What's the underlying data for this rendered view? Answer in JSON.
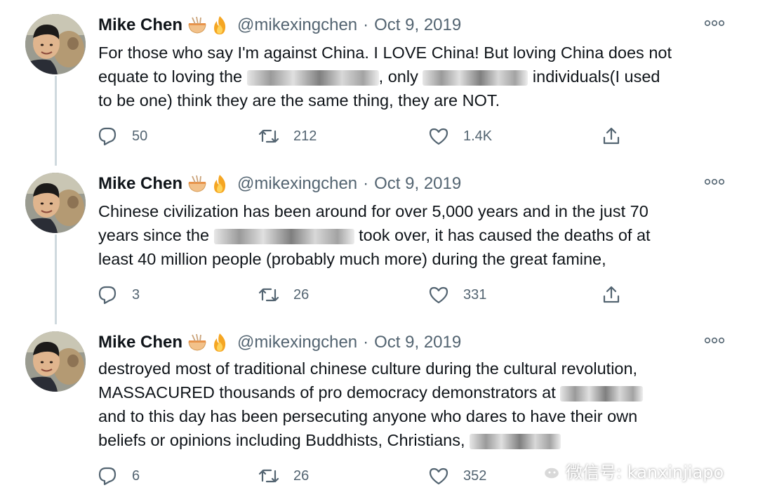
{
  "tweets": [
    {
      "author": "Mike Chen",
      "handle": "@mikexingchen",
      "separator": "·",
      "date": "Oct 9, 2019",
      "lines": [
        [
          "For those who say I'm against China. I LOVE China! But loving China does not"
        ],
        [
          "equate to loving the ",
          "",
          ", only ",
          "",
          " individuals(I used"
        ],
        [
          "to be one) think they are the same thing, they are NOT."
        ]
      ],
      "replies": "50",
      "retweets": "212",
      "likes": "1.4K"
    },
    {
      "author": "Mike Chen",
      "handle": "@mikexingchen",
      "separator": "·",
      "date": "Oct 9, 2019",
      "lines": [
        [
          "Chinese civilization has been around for over 5,000 years and in the just 70"
        ],
        [
          "years since the ",
          "",
          " took over, it has caused the deaths of at"
        ],
        [
          "least 40 million people (probably much more) during the great famine,"
        ]
      ],
      "replies": "3",
      "retweets": "26",
      "likes": "331"
    },
    {
      "author": "Mike Chen",
      "handle": "@mikexingchen",
      "separator": "·",
      "date": "Oct 9, 2019",
      "lines": [
        [
          "destroyed most of traditional chinese culture during the cultural revolution,"
        ],
        [
          "MASSACURED thousands of pro democracy demonstrators at ",
          ""
        ],
        [
          "and to this day has been persecuting anyone who dares to have their own"
        ],
        [
          "beliefs or opinions including Buddhists, Christians, ",
          ""
        ]
      ],
      "replies": "6",
      "retweets": "26",
      "likes": "352"
    }
  ],
  "watermark": {
    "text": "微信号: kanxinjiapo",
    "icon": "wechat-icon"
  },
  "icons": {
    "reply": "reply-icon",
    "retweet": "retweet-icon",
    "like": "heart-icon",
    "share": "share-icon",
    "more": "more-icon",
    "badges": [
      "noodle-bowl-icon",
      "fire-icon"
    ]
  },
  "colors": {
    "text": "#0f1419",
    "secondary": "#536471",
    "thread_line": "#cfd9de"
  }
}
